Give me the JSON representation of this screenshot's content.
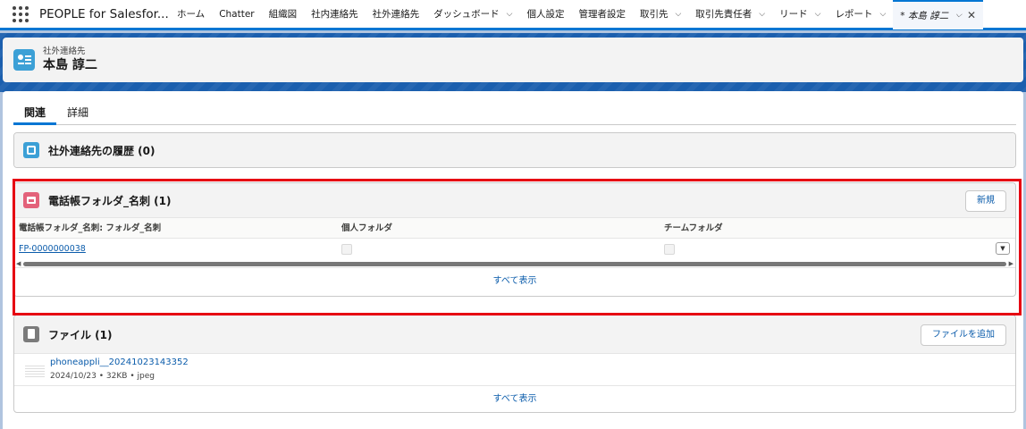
{
  "app": {
    "name": "PEOPLE for Salesfor..."
  },
  "nav": {
    "items": [
      {
        "label": "ホーム",
        "has_menu": false
      },
      {
        "label": "Chatter",
        "has_menu": false
      },
      {
        "label": "組織図",
        "has_menu": false
      },
      {
        "label": "社内連絡先",
        "has_menu": false
      },
      {
        "label": "社外連絡先",
        "has_menu": false
      },
      {
        "label": "ダッシュボード",
        "has_menu": true
      },
      {
        "label": "個人設定",
        "has_menu": false
      },
      {
        "label": "管理者設定",
        "has_menu": false
      },
      {
        "label": "取引先",
        "has_menu": true
      },
      {
        "label": "取引先責任者",
        "has_menu": true
      },
      {
        "label": "リード",
        "has_menu": true
      },
      {
        "label": "レポート",
        "has_menu": true
      }
    ],
    "active_tab": "* 本島 諄二"
  },
  "record": {
    "type": "社外連絡先",
    "name": "本島 諄二"
  },
  "tabs": [
    "関連",
    "詳細"
  ],
  "history_card": {
    "title": "社外連絡先の履歴 (0)"
  },
  "folder_card": {
    "title": "電話帳フォルダ_名刺 (1)",
    "new_button": "新規",
    "columns": [
      "電話帳フォルダ_名刺: フォルダ_名刺",
      "個人フォルダ",
      "チームフォルダ"
    ],
    "rows": [
      {
        "name": "FP-0000000038",
        "personal": false,
        "team": false
      }
    ],
    "view_all": "すべて表示"
  },
  "files_card": {
    "title": "ファイル (1)",
    "add_button": "ファイルを追加",
    "files": [
      {
        "name": "phoneappli__20241023143352",
        "date": "2024/10/23",
        "size": "32KB",
        "type": "jpeg"
      }
    ],
    "view_all": "すべて表示"
  },
  "colors": {
    "brand_blue": "#0176d3",
    "highlight_red": "#e60012"
  }
}
